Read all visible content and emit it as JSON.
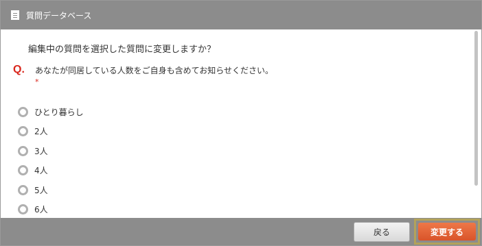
{
  "header": {
    "title": "質問データベース",
    "icon": "document-icon"
  },
  "confirm_text": "編集中の質問を選択した質問に変更しますか？",
  "question": {
    "marker": "Q.",
    "text": "あなたが同居している人数をご自身も含めてお知らせください。",
    "required_mark": "*"
  },
  "options": [
    {
      "label": "ひとり暮らし"
    },
    {
      "label": "2人"
    },
    {
      "label": "3人"
    },
    {
      "label": "4人"
    },
    {
      "label": "5人"
    },
    {
      "label": "6人"
    }
  ],
  "footer": {
    "back_label": "戻る",
    "change_label": "変更する"
  },
  "colors": {
    "header": "#8c8c8c",
    "accent": "#e0612f",
    "required": "#d9261c"
  }
}
